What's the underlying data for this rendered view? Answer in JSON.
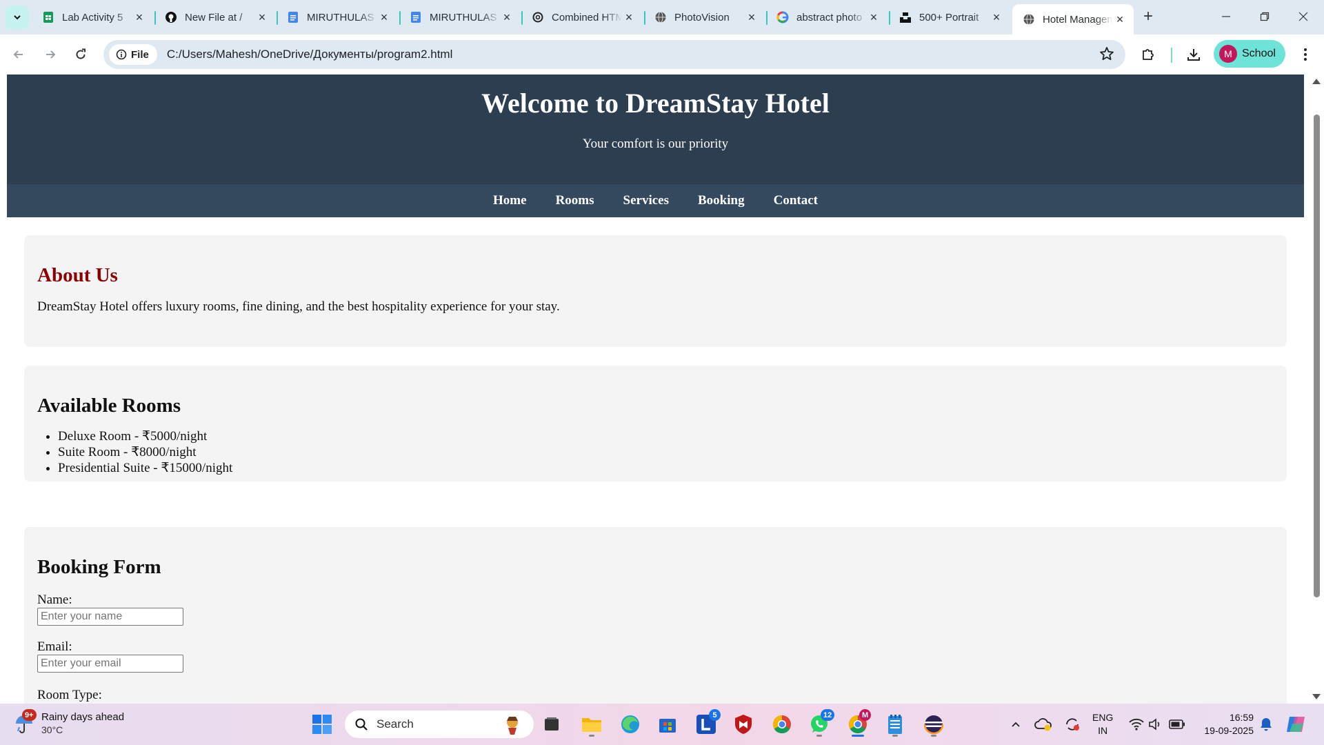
{
  "browser": {
    "tabs": [
      {
        "title": "Lab Activity 5",
        "icon": "sheets-icon",
        "active": false
      },
      {
        "title": "New File at /",
        "icon": "github-icon",
        "active": false
      },
      {
        "title": "MIRUTHULAS",
        "icon": "docs-icon",
        "active": false
      },
      {
        "title": "MIRUTHULAS",
        "icon": "docs-icon",
        "active": false
      },
      {
        "title": "Combined HTML",
        "icon": "openai-icon",
        "active": false
      },
      {
        "title": "PhotoVision",
        "icon": "globe-icon",
        "active": false
      },
      {
        "title": "abstract photo",
        "icon": "google-icon",
        "active": false
      },
      {
        "title": "500+ Portrait",
        "icon": "unsplash-icon",
        "active": false
      },
      {
        "title": "Hotel Management",
        "icon": "globe-icon",
        "active": true
      }
    ],
    "address": {
      "chip_label": "File",
      "url": "C:/Users/Mahesh/OneDrive/Документы/program2.html"
    },
    "profile_label": "School",
    "profile_initial": "M",
    "accent": "#6ee3d8"
  },
  "page": {
    "header": {
      "title": "Welcome to DreamStay Hotel",
      "tagline": "Your comfort is our priority"
    },
    "nav": [
      "Home",
      "Rooms",
      "Services",
      "Booking",
      "Contact"
    ],
    "about": {
      "heading": "About Us",
      "text": "DreamStay Hotel offers luxury rooms, fine dining, and the best hospitality experience for your stay."
    },
    "rooms": {
      "heading": "Available Rooms",
      "items": [
        "Deluxe Room - ₹5000/night",
        "Suite Room - ₹8000/night",
        "Presidential Suite - ₹15000/night"
      ]
    },
    "booking": {
      "heading": "Booking Form",
      "name_label": "Name:",
      "name_placeholder": "Enter your name",
      "email_label": "Email:",
      "email_placeholder": "Enter your email",
      "room_type_label": "Room Type:"
    },
    "colors": {
      "header_bg": "#2c3e50",
      "nav_bg": "#34495e",
      "about_heading": "#8b0000"
    }
  },
  "taskbar": {
    "weather": {
      "text": "Rainy days ahead",
      "temp": "30°C",
      "badge": "9+"
    },
    "search_placeholder": "Search",
    "badges": {
      "lens": "5",
      "whatsapp": "12",
      "chrome_profile": "M"
    },
    "language": {
      "line1": "ENG",
      "line2": "IN"
    },
    "clock": {
      "time": "16:59",
      "date": "19-09-2025"
    }
  }
}
